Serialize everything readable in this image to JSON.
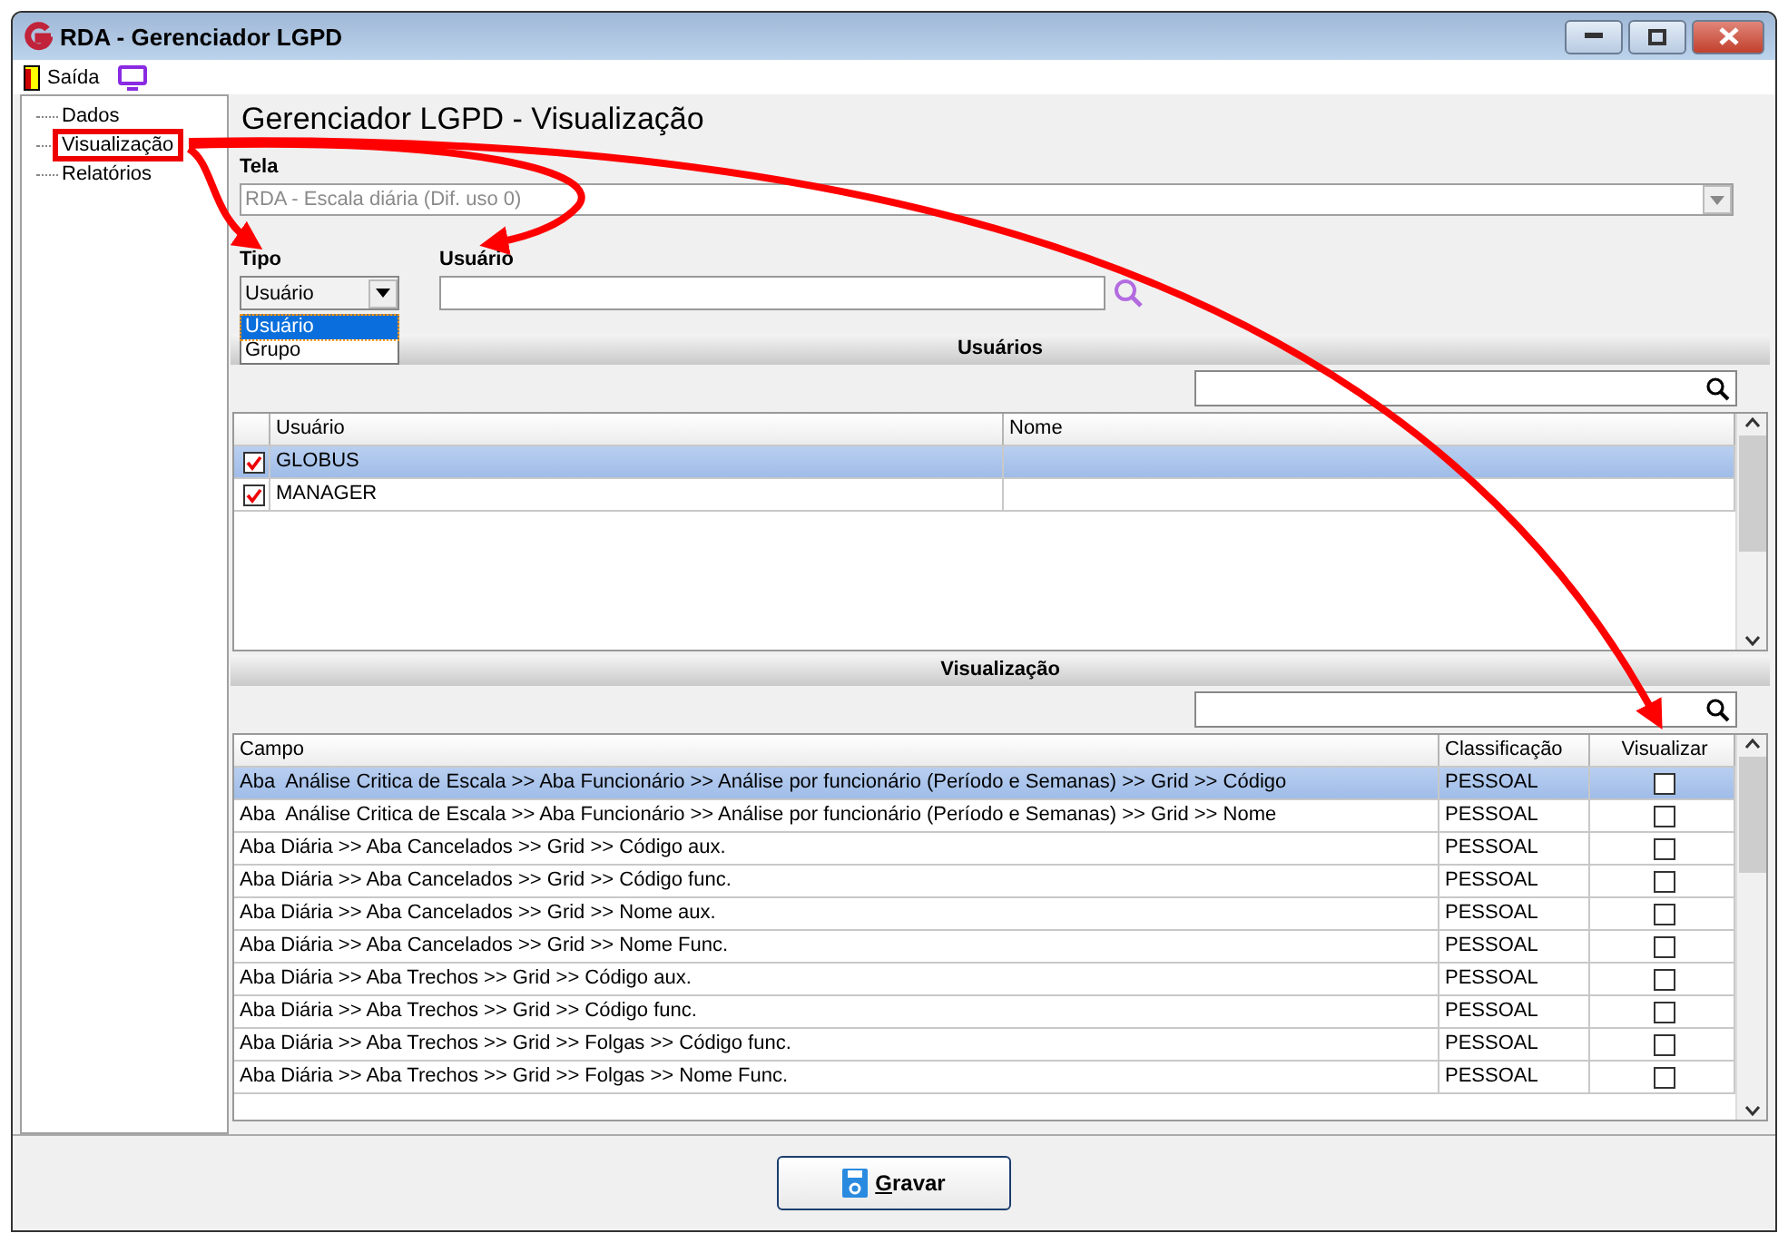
{
  "window": {
    "title": "RDA - Gerenciador LGPD"
  },
  "menu": [
    {
      "label": "Saída",
      "kind": "exit"
    },
    {
      "kind": "monitor"
    }
  ],
  "sidebar": {
    "items": [
      {
        "label": "Dados",
        "highlighted": false
      },
      {
        "label": "Visualização",
        "highlighted": true
      },
      {
        "label": "Relatórios",
        "highlighted": false
      }
    ]
  },
  "page_title": "Gerenciador LGPD - Visualização",
  "tela": {
    "label": "Tela",
    "value": "RDA - Escala diária (Dif. uso 0)",
    "disabled": true
  },
  "tipo": {
    "label": "Tipo",
    "value": "Usuário",
    "options": [
      {
        "label": "Usuário",
        "selected": true
      },
      {
        "label": "Grupo",
        "selected": false
      }
    ]
  },
  "usuario": {
    "label": "Usuário"
  },
  "usuarios": {
    "title": "Usuários",
    "columns": [
      "Usuário",
      "Nome"
    ],
    "rows": [
      {
        "checked": true,
        "selected": true,
        "usuario": "GLOBUS"
      },
      {
        "checked": true,
        "selected": false,
        "usuario": "MANAGER"
      }
    ]
  },
  "visualizacao": {
    "title": "Visualização",
    "columns": [
      "Campo",
      "Classificação",
      "Visualizar"
    ],
    "rows": [
      {
        "selected": true,
        "campo": "Aba  Análise Critica de Escala >> Aba Funcionário >> Análise por funcionário (Período e Semanas) >> Grid >> Código",
        "classificacao": "PESSOAL",
        "checked": false
      },
      {
        "selected": false,
        "campo": "Aba  Análise Critica de Escala >> Aba Funcionário >> Análise por funcionário (Período e Semanas) >> Grid >> Nome",
        "classificacao": "PESSOAL",
        "checked": false
      },
      {
        "selected": false,
        "campo": "Aba Diária >> Aba Cancelados >> Grid >> Código aux.",
        "classificacao": "PESSOAL",
        "checked": false
      },
      {
        "selected": false,
        "campo": "Aba Diária >> Aba Cancelados >> Grid >> Código func.",
        "classificacao": "PESSOAL",
        "checked": false
      },
      {
        "selected": false,
        "campo": "Aba Diária >> Aba Cancelados >> Grid >> Nome aux.",
        "classificacao": "PESSOAL",
        "checked": false
      },
      {
        "selected": false,
        "campo": "Aba Diária >> Aba Cancelados >> Grid >> Nome Func.",
        "classificacao": "PESSOAL",
        "checked": false
      },
      {
        "selected": false,
        "campo": "Aba Diária >> Aba Trechos >> Grid >> Código aux.",
        "classificacao": "PESSOAL",
        "checked": false
      },
      {
        "selected": false,
        "campo": "Aba Diária >> Aba Trechos >> Grid >> Código func.",
        "classificacao": "PESSOAL",
        "checked": false
      },
      {
        "selected": false,
        "campo": "Aba Diária >> Aba Trechos >> Grid >> Folgas >> Código func.",
        "classificacao": "PESSOAL",
        "checked": false
      },
      {
        "selected": false,
        "campo": "Aba Diária >> Aba Trechos >> Grid >> Folgas >> Nome Func.",
        "classificacao": "PESSOAL",
        "checked": false
      }
    ]
  },
  "save_button": {
    "label": "Gravar"
  }
}
